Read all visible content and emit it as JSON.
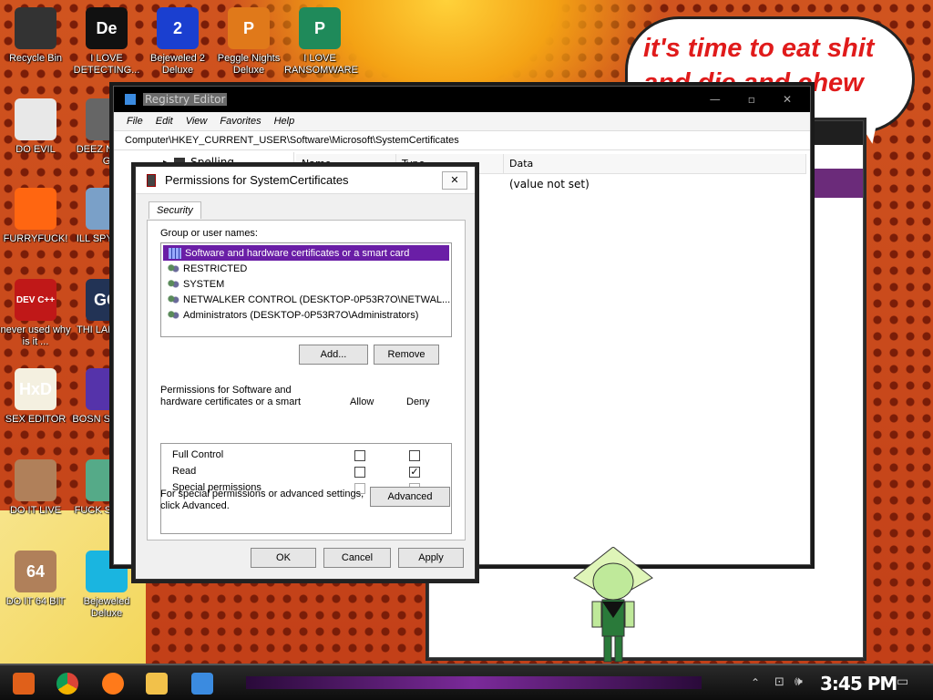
{
  "desktop_icons": [
    {
      "label": "Recycle Bin",
      "name": "recycle-bin-icon",
      "color": "#333333"
    },
    {
      "label": "I LOVE DETECTING...",
      "name": "detective-app-icon",
      "color": "#111111",
      "glyph": "De"
    },
    {
      "label": "Bejeweled 2 Deluxe",
      "name": "bejeweled2-icon",
      "color": "#1a3fd0",
      "glyph": "2"
    },
    {
      "label": "Peggle Nights Deluxe",
      "name": "peggle-icon",
      "color": "#e0791a",
      "glyph": "P"
    },
    {
      "label": "I LOVE RANSOMWARE",
      "name": "publisher-icon",
      "color": "#1f8a5a",
      "glyph": "P"
    },
    {
      "label": "DO EVIL",
      "name": "chrome-icon",
      "color": "#e8e8e8"
    },
    {
      "label": "DEEZ N HAH G",
      "name": "app-icon-deez",
      "color": "#666666"
    },
    {
      "label": "FURRYFUCK!",
      "name": "firefox-icon",
      "color": "#ff6611"
    },
    {
      "label": "ILL SPY YOU",
      "name": "spy-app-icon",
      "color": "#7aa0c8"
    },
    {
      "label": "never used why is it ...",
      "name": "devcpp-icon",
      "color": "#c01818",
      "glyph": "DEV C++"
    },
    {
      "label": "THI LANGUA",
      "name": "go-language-icon",
      "color": "#223355",
      "glyph": "GO"
    },
    {
      "label": "SEX EDITOR",
      "name": "hxd-editor-icon",
      "color": "#f4f0e0",
      "glyph": "HxD"
    },
    {
      "label": "BOSN SIMULA",
      "name": "bosnia-sim-icon",
      "color": "#5533aa"
    },
    {
      "label": "DO IT LIVE",
      "name": "portrait-app-icon",
      "color": "#b0805a"
    },
    {
      "label": "FUCK S ELVE",
      "name": "elf-app-icon",
      "color": "#55aa88"
    },
    {
      "label": "DO IT 64 BIT",
      "name": "portrait-64bit-icon",
      "color": "#b0805a",
      "glyph": "64"
    },
    {
      "label": "Bejeweled Deluxe",
      "name": "bejeweled-icon",
      "color": "#1ab5e0"
    }
  ],
  "speech_bubble": {
    "text": "it's time to eat shit and die and chew"
  },
  "registry_editor": {
    "title": "Registry Editor",
    "menu": [
      "File",
      "Edit",
      "View",
      "Favorites",
      "Help"
    ],
    "address": "Computer\\HKEY_CURRENT_USER\\Software\\Microsoft\\SystemCertificates",
    "tree_node": "Spelling",
    "columns": [
      "Name",
      "Type",
      "Data"
    ],
    "row": {
      "type": "ɛ",
      "data": "(value not set)"
    }
  },
  "permissions_dialog": {
    "title": "Permissions for SystemCertificates",
    "tab": "Security",
    "group_label": "Group or user names:",
    "groups": [
      "Software and hardware certificates or a smart card",
      "RESTRICTED",
      "SYSTEM",
      "NETWALKER CONTROL (DESKTOP-0P53R7O\\NETWAL...",
      "Administrators (DESKTOP-0P53R7O\\Administrators)"
    ],
    "selected_index": 0,
    "add_button": "Add...",
    "remove_button": "Remove",
    "perm_label_line1": "Permissions for Software and",
    "perm_label_line2": "hardware certificates or a smart",
    "allow_label": "Allow",
    "deny_label": "Deny",
    "permissions": [
      {
        "name": "Full Control",
        "allow": false,
        "deny": false,
        "disabled": false
      },
      {
        "name": "Read",
        "allow": false,
        "deny": true,
        "disabled": false
      },
      {
        "name": "Special permissions",
        "allow": false,
        "deny": false,
        "disabled": true
      }
    ],
    "advanced_text_line1": "For special permissions or advanced settings,",
    "advanced_text_line2": "click Advanced.",
    "advanced_button": "Advanced",
    "ok_button": "OK",
    "cancel_button": "Cancel",
    "apply_button": "Apply",
    "close_glyph": "✕"
  },
  "taskbar": {
    "clock": "3:45 PM",
    "apps": [
      "start-icon",
      "chrome-icon",
      "firefox-icon",
      "file-explorer-icon",
      "registry-editor-icon"
    ]
  }
}
